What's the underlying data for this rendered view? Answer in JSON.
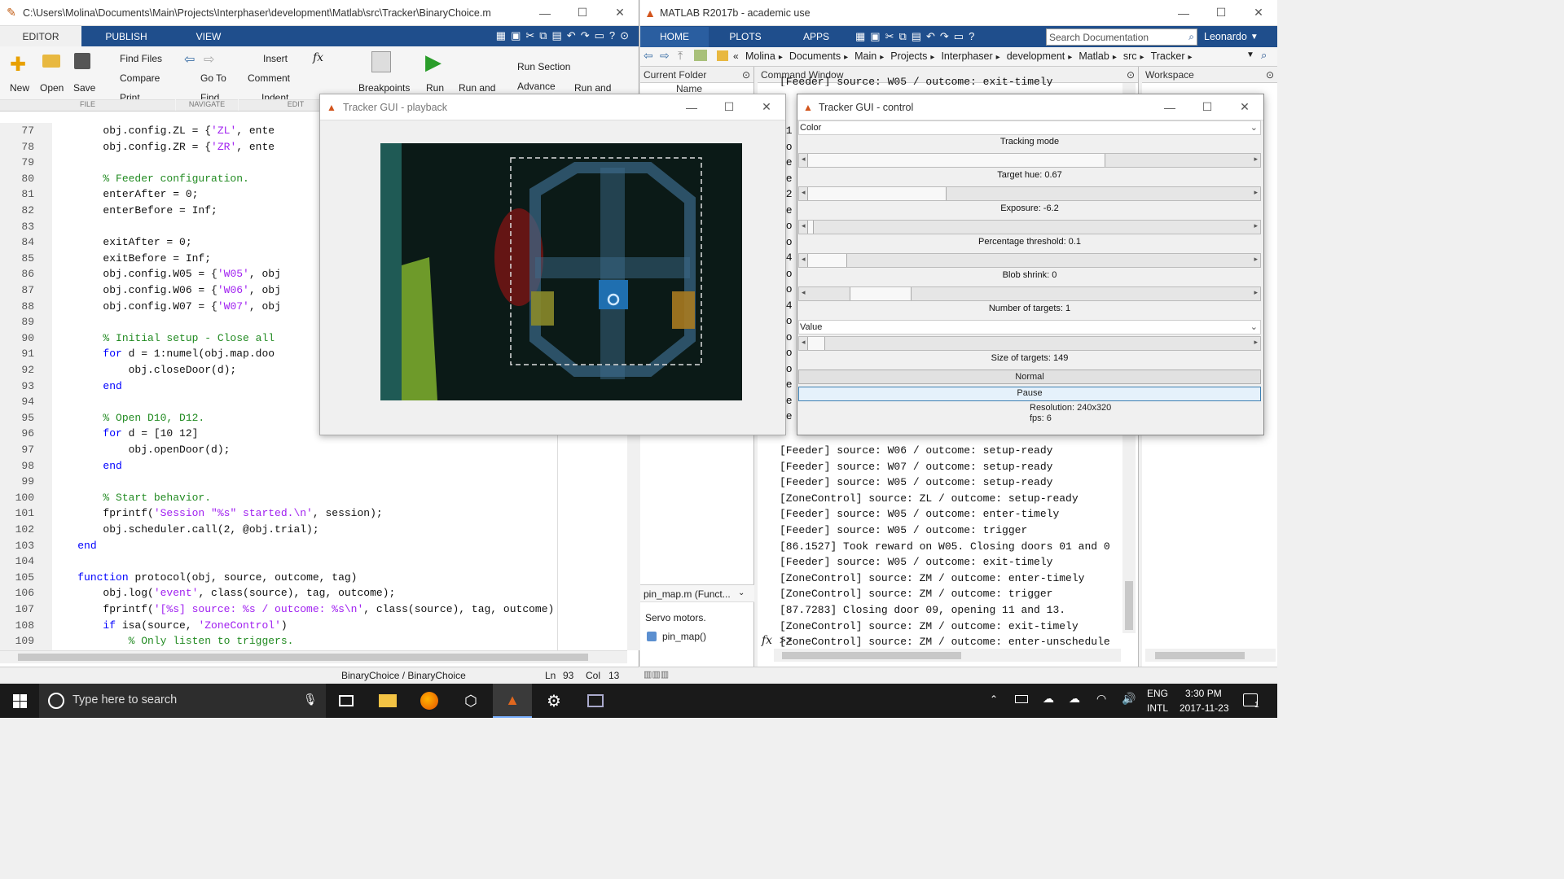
{
  "editor": {
    "title": "C:\\Users\\Molina\\Documents\\Main\\Projects\\Interphaser\\development\\Matlab\\src\\Tracker\\BinaryChoice.m",
    "tabs": [
      "EDITOR",
      "PUBLISH",
      "VIEW"
    ],
    "ribbon": {
      "new": "New",
      "open": "Open",
      "save": "Save",
      "find_files": "Find Files",
      "compare": "Compare",
      "print": "Print",
      "go_to": "Go To",
      "find": "Find",
      "insert": "Insert",
      "comment": "Comment",
      "indent": "Indent",
      "breakpoints": "Breakpoints",
      "run": "Run",
      "run_and": "Run and",
      "run_section": "Run Section",
      "advance": "Advance",
      "run_and2": "Run and",
      "grp_file": "FILE",
      "grp_navigate": "NAVIGATE",
      "grp_edit": "EDIT"
    },
    "status": {
      "file": "BinaryChoice / BinaryChoice",
      "ln_label": "Ln",
      "ln": "93",
      "col_label": "Col",
      "col": "13"
    }
  },
  "code_lines": [
    {
      "n": "77",
      "t": "        obj.config.ZL = {'ZL', ente"
    },
    {
      "n": "78",
      "t": "        obj.config.ZR = {'ZR', ente"
    },
    {
      "n": "79",
      "t": ""
    },
    {
      "n": "80",
      "t": "        % Feeder configuration."
    },
    {
      "n": "81",
      "t": "        enterAfter = 0;"
    },
    {
      "n": "82",
      "t": "        enterBefore = Inf;"
    },
    {
      "n": "83",
      "t": ""
    },
    {
      "n": "84",
      "t": "        exitAfter = 0;"
    },
    {
      "n": "85",
      "t": "        exitBefore = Inf;"
    },
    {
      "n": "86",
      "t": "        obj.config.W05 = {'W05', obj"
    },
    {
      "n": "87",
      "t": "        obj.config.W06 = {'W06', obj"
    },
    {
      "n": "88",
      "t": "        obj.config.W07 = {'W07', obj"
    },
    {
      "n": "89",
      "t": ""
    },
    {
      "n": "90",
      "t": "        % Initial setup - Close all"
    },
    {
      "n": "91",
      "t": "        for d = 1:numel(obj.map.doo"
    },
    {
      "n": "92",
      "t": "            obj.closeDoor(d);"
    },
    {
      "n": "93",
      "t": "        end"
    },
    {
      "n": "94",
      "t": ""
    },
    {
      "n": "95",
      "t": "        % Open D10, D12."
    },
    {
      "n": "96",
      "t": "        for d = [10 12]"
    },
    {
      "n": "97",
      "t": "            obj.openDoor(d);"
    },
    {
      "n": "98",
      "t": "        end"
    },
    {
      "n": "99",
      "t": ""
    },
    {
      "n": "100",
      "t": "        % Start behavior."
    },
    {
      "n": "101",
      "t": "        fprintf('Session \"%s\" started.\\n', session);"
    },
    {
      "n": "102",
      "t": "        obj.scheduler.call(2, @obj.trial);"
    },
    {
      "n": "103",
      "t": "    end"
    },
    {
      "n": "104",
      "t": ""
    },
    {
      "n": "105",
      "t": "    function protocol(obj, source, outcome, tag)"
    },
    {
      "n": "106",
      "t": "        obj.log('event', class(source), tag, outcome);"
    },
    {
      "n": "107",
      "t": "        fprintf('[%s] source: %s / outcome: %s\\n', class(source), tag, outcome)"
    },
    {
      "n": "108",
      "t": "        if isa(source, 'ZoneControl')"
    },
    {
      "n": "109",
      "t": "            % Only listen to triggers."
    }
  ],
  "matlab": {
    "title": "MATLAB R2017b - academic use",
    "tabs": [
      "HOME",
      "PLOTS",
      "APPS"
    ],
    "search_placeholder": "Search Documentation",
    "user": "Leonardo",
    "breadcrumb": [
      "Molina",
      "Documents",
      "Main",
      "Projects",
      "Interphaser",
      "development",
      "Matlab",
      "src",
      "Tracker"
    ],
    "current_folder": "Current Folder",
    "name_col": "Name",
    "command_window": "Command Window",
    "workspace": "Workspace",
    "file_detail": "pin_map.m  (Funct...",
    "file_desc": "Servo motors.",
    "file_func": "pin_map()",
    "prompt": ">>"
  },
  "cmd_top": "[Feeder] source: W05 / outcome: exit-timely",
  "cmd_lines": [
    "[Feeder] source: W06 / outcome: setup-ready",
    "[Feeder] source: W07 / outcome: setup-ready",
    "[Feeder] source: W05 / outcome: setup-ready",
    "[ZoneControl] source: ZL / outcome: setup-ready",
    "[Feeder] source: W05 / outcome: enter-timely",
    "[Feeder] source: W05 / outcome: trigger",
    "[86.1527] Took reward on W05. Closing doors 01 and 0",
    "[Feeder] source: W05 / outcome: exit-timely",
    "[ZoneControl] source: ZM / outcome: enter-timely",
    "[ZoneControl] source: ZM / outcome: trigger",
    "[87.7283] Closing door 09, opening 11 and 13.",
    "[ZoneControl] source: ZM / outcome: exit-timely",
    "[ZoneControl] source: ZM / outcome: enter-unschedule"
  ],
  "cmd_left_frag": [
    "81",
    "Zo",
    "Fe",
    "Fe",
    "82",
    "Fe",
    "Zo",
    "Zo",
    "84",
    "Zo",
    "Zo",
    "84",
    "Zo",
    "Zo",
    "Zo",
    "Zo",
    "Fe",
    "Fe",
    "Fe"
  ],
  "playback": {
    "title": "Tracker GUI - playback"
  },
  "control": {
    "title": "Tracker GUI - control",
    "color_select": "Color",
    "tracking_mode": "Tracking mode",
    "target_hue": "Target hue: 0.67",
    "exposure": "Exposure: -6.2",
    "percentage_threshold": "Percentage threshold: 0.1",
    "blob_shrink": "Blob shrink: 0",
    "number_of_targets": "Number of targets: 1",
    "value_select": "Value",
    "size_of_targets": "Size of targets: 149",
    "normal_btn": "Normal",
    "pause_btn": "Pause",
    "resolution": "Resolution: 240x320",
    "fps": "fps: 6"
  },
  "taskbar": {
    "search": "Type here to search",
    "lang1": "ENG",
    "lang2": "INTL",
    "time": "3:30 PM",
    "date": "2017-11-23",
    "notif": "1"
  }
}
